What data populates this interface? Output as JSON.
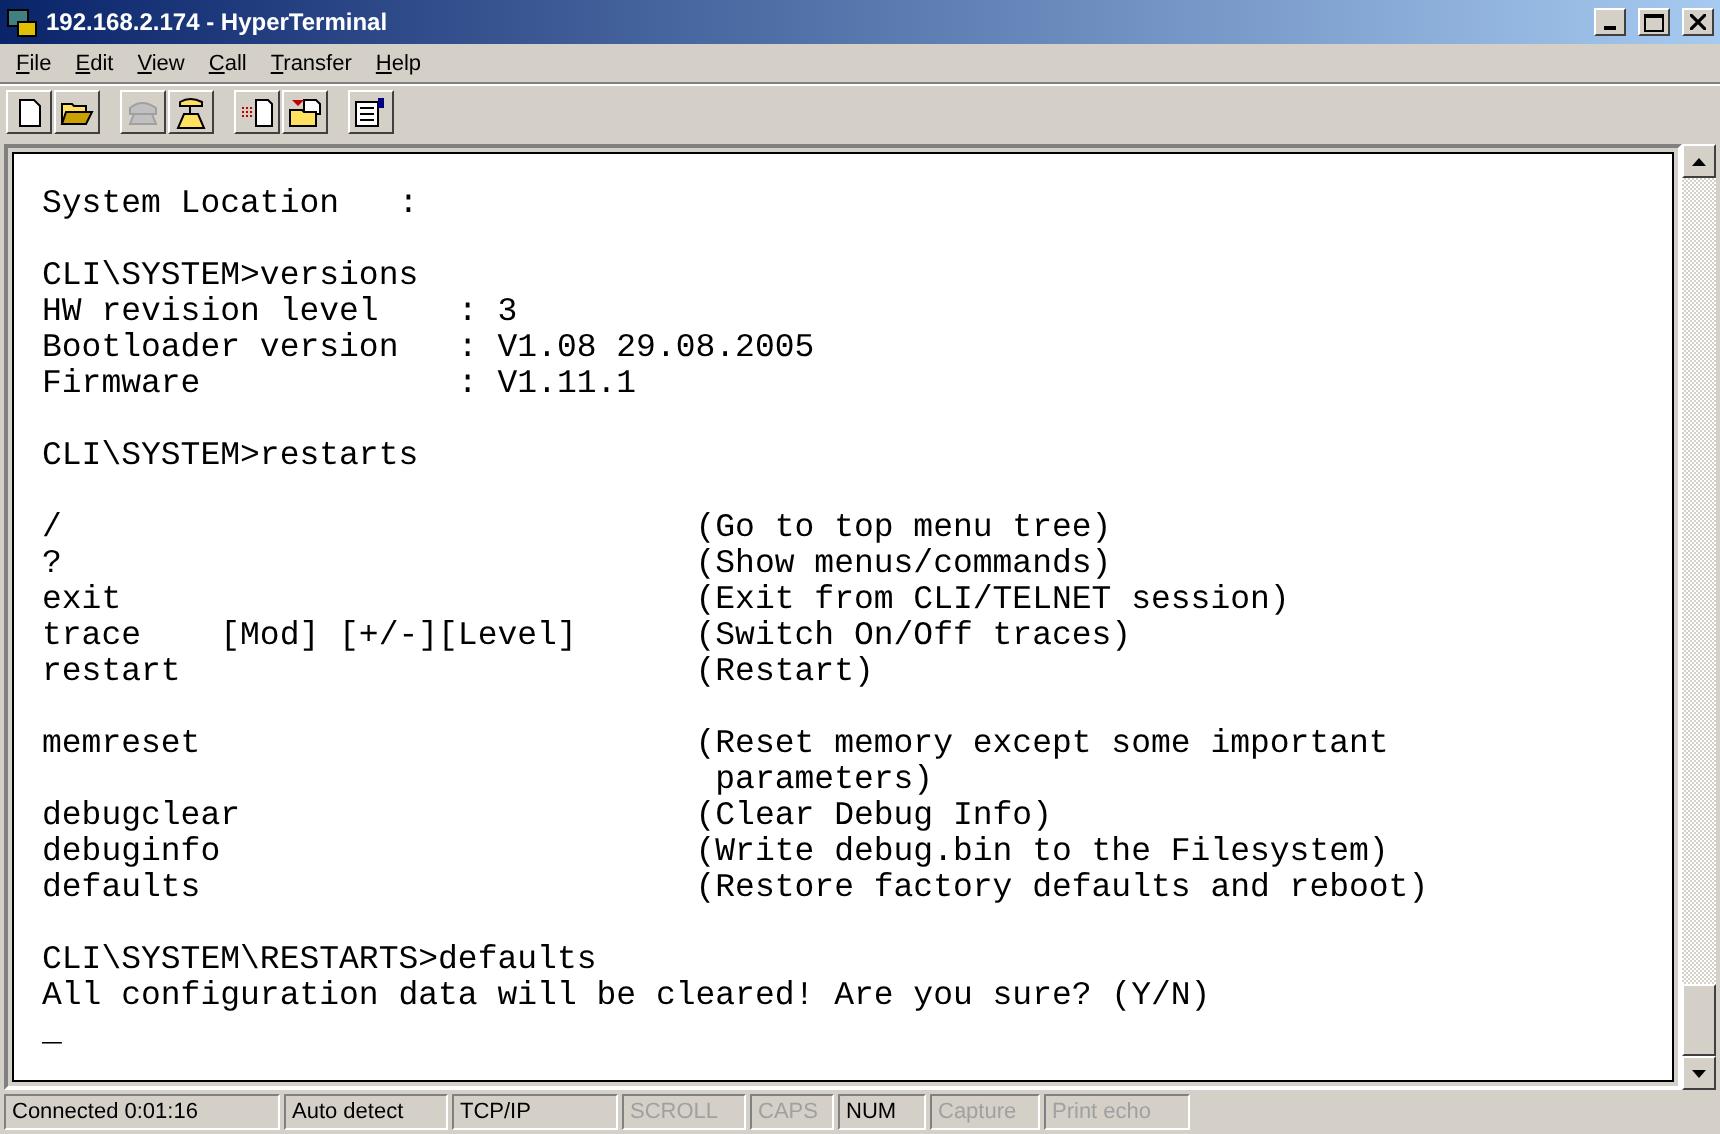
{
  "window": {
    "title": "192.168.2.174 - HyperTerminal"
  },
  "menu": [
    {
      "accel": "F",
      "rest": "ile"
    },
    {
      "accel": "E",
      "rest": "dit"
    },
    {
      "accel": "V",
      "rest": "iew"
    },
    {
      "accel": "C",
      "rest": "all"
    },
    {
      "accel": "T",
      "rest": "ransfer"
    },
    {
      "accel": "H",
      "rest": "elp"
    }
  ],
  "toolbar": [
    {
      "kind": "new",
      "disabled": false
    },
    {
      "kind": "open",
      "disabled": false
    },
    {
      "kind": "sep"
    },
    {
      "kind": "connect",
      "disabled": true
    },
    {
      "kind": "disconnect",
      "disabled": false
    },
    {
      "kind": "sep"
    },
    {
      "kind": "send",
      "disabled": false
    },
    {
      "kind": "receive",
      "disabled": false
    },
    {
      "kind": "sep"
    },
    {
      "kind": "properties",
      "disabled": false
    }
  ],
  "terminal": {
    "lines": [
      {
        "kind": "text",
        "text": "System Location   :"
      },
      {
        "kind": "blank"
      },
      {
        "kind": "text",
        "text": "CLI\\SYSTEM>versions"
      },
      {
        "kind": "text",
        "text": "HW revision level    : 3"
      },
      {
        "kind": "text",
        "text": "Bootloader version   : V1.08 29.08.2005"
      },
      {
        "kind": "text",
        "text": "Firmware             : V1.11.1"
      },
      {
        "kind": "blank"
      },
      {
        "kind": "text",
        "text": "CLI\\SYSTEM>restarts"
      },
      {
        "kind": "blank"
      },
      {
        "kind": "text",
        "text": "/                                (Go to top menu tree)"
      },
      {
        "kind": "text",
        "text": "?                                (Show menus/commands)"
      },
      {
        "kind": "text",
        "text": "exit                             (Exit from CLI/TELNET session)"
      },
      {
        "kind": "text",
        "text": "trace    [Mod] [+/-][Level]      (Switch On/Off traces)"
      },
      {
        "kind": "text",
        "text": "restart                          (Restart)"
      },
      {
        "kind": "blank"
      },
      {
        "kind": "text",
        "text": "memreset                         (Reset memory except some important"
      },
      {
        "kind": "text",
        "text": "                                  parameters)"
      },
      {
        "kind": "text",
        "text": "debugclear                       (Clear Debug Info)"
      },
      {
        "kind": "text",
        "text": "debuginfo                        (Write debug.bin to the Filesystem)"
      },
      {
        "kind": "text",
        "text": "defaults                         (Restore factory defaults and reboot)"
      },
      {
        "kind": "blank"
      },
      {
        "kind": "text",
        "text": "CLI\\SYSTEM\\RESTARTS>defaults"
      },
      {
        "kind": "text",
        "text": "All configuration data will be cleared! Are you sure? (Y/N)"
      },
      {
        "kind": "cursor",
        "text": "_"
      }
    ]
  },
  "status_bar": [
    {
      "text": "Connected 0:01:16",
      "disabled": false
    },
    {
      "text": "Auto detect",
      "disabled": false
    },
    {
      "text": "TCP/IP",
      "disabled": false
    },
    {
      "text": "SCROLL",
      "disabled": true
    },
    {
      "text": "CAPS",
      "disabled": true
    },
    {
      "text": "NUM",
      "disabled": false
    },
    {
      "text": "Capture",
      "disabled": true
    },
    {
      "text": "Print echo",
      "disabled": true
    }
  ]
}
